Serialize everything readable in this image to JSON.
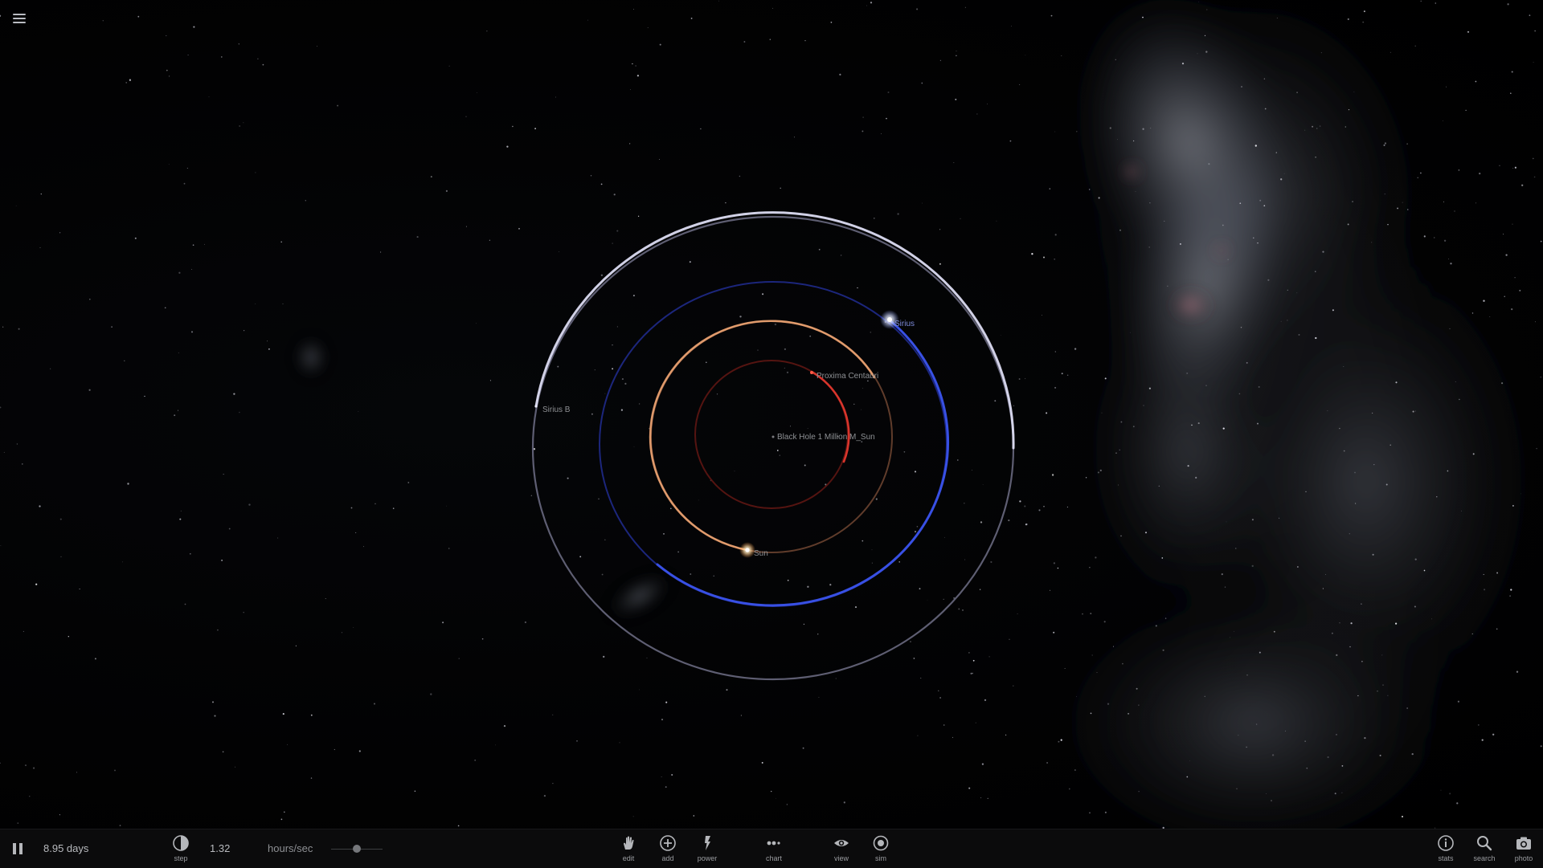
{
  "scene": {
    "bodies": [
      {
        "id": "black-hole",
        "label": "Black Hole 1 Million M_Sun"
      },
      {
        "id": "proxima",
        "label": "Proxima Centauri"
      },
      {
        "id": "sun",
        "label": "Sun"
      },
      {
        "id": "sirius",
        "label": "Sirius"
      },
      {
        "id": "sirius-b",
        "label": "Sirius B"
      }
    ],
    "colors": {
      "proxima_orbit": "#c8322a",
      "sun_orbit": "#e0925a",
      "sirius_orbit": "#3546d6",
      "sirius_b_orbit": "#d4d4ec"
    }
  },
  "toolbar": {
    "time": "8.95 days",
    "rate_value": "1.32",
    "rate_unit": "hours/sec",
    "rate_slider_fraction": 0.5,
    "tools": [
      {
        "id": "edit",
        "label": "edit",
        "icon": "hand-icon"
      },
      {
        "id": "add",
        "label": "add",
        "icon": "plus-circle-icon"
      },
      {
        "id": "power",
        "label": "power",
        "icon": "lightning-icon"
      },
      {
        "id": "chart",
        "label": "chart",
        "icon": "dots-chart-icon"
      },
      {
        "id": "view",
        "label": "view",
        "icon": "eye-icon"
      },
      {
        "id": "sim",
        "label": "sim",
        "icon": "target-icon"
      },
      {
        "id": "stats",
        "label": "stats",
        "icon": "info-icon"
      },
      {
        "id": "search",
        "label": "search",
        "icon": "magnifier-icon"
      },
      {
        "id": "photo",
        "label": "photo",
        "icon": "camera-icon"
      }
    ]
  }
}
